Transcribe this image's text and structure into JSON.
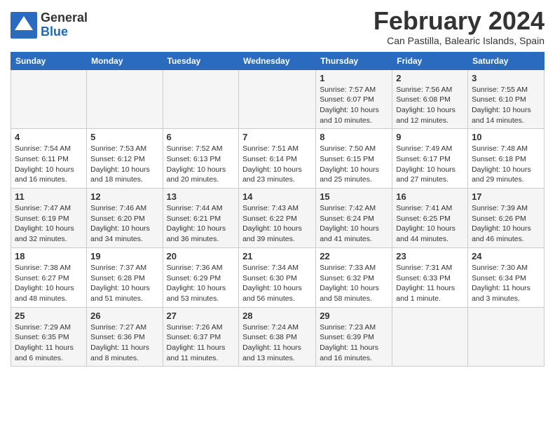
{
  "logo": {
    "general": "General",
    "blue": "Blue"
  },
  "header": {
    "month": "February 2024",
    "location": "Can Pastilla, Balearic Islands, Spain"
  },
  "days_of_week": [
    "Sunday",
    "Monday",
    "Tuesday",
    "Wednesday",
    "Thursday",
    "Friday",
    "Saturday"
  ],
  "weeks": [
    [
      {
        "day": "",
        "info": ""
      },
      {
        "day": "",
        "info": ""
      },
      {
        "day": "",
        "info": ""
      },
      {
        "day": "",
        "info": ""
      },
      {
        "day": "1",
        "info": "Sunrise: 7:57 AM\nSunset: 6:07 PM\nDaylight: 10 hours\nand 10 minutes."
      },
      {
        "day": "2",
        "info": "Sunrise: 7:56 AM\nSunset: 6:08 PM\nDaylight: 10 hours\nand 12 minutes."
      },
      {
        "day": "3",
        "info": "Sunrise: 7:55 AM\nSunset: 6:10 PM\nDaylight: 10 hours\nand 14 minutes."
      }
    ],
    [
      {
        "day": "4",
        "info": "Sunrise: 7:54 AM\nSunset: 6:11 PM\nDaylight: 10 hours\nand 16 minutes."
      },
      {
        "day": "5",
        "info": "Sunrise: 7:53 AM\nSunset: 6:12 PM\nDaylight: 10 hours\nand 18 minutes."
      },
      {
        "day": "6",
        "info": "Sunrise: 7:52 AM\nSunset: 6:13 PM\nDaylight: 10 hours\nand 20 minutes."
      },
      {
        "day": "7",
        "info": "Sunrise: 7:51 AM\nSunset: 6:14 PM\nDaylight: 10 hours\nand 23 minutes."
      },
      {
        "day": "8",
        "info": "Sunrise: 7:50 AM\nSunset: 6:15 PM\nDaylight: 10 hours\nand 25 minutes."
      },
      {
        "day": "9",
        "info": "Sunrise: 7:49 AM\nSunset: 6:17 PM\nDaylight: 10 hours\nand 27 minutes."
      },
      {
        "day": "10",
        "info": "Sunrise: 7:48 AM\nSunset: 6:18 PM\nDaylight: 10 hours\nand 29 minutes."
      }
    ],
    [
      {
        "day": "11",
        "info": "Sunrise: 7:47 AM\nSunset: 6:19 PM\nDaylight: 10 hours\nand 32 minutes."
      },
      {
        "day": "12",
        "info": "Sunrise: 7:46 AM\nSunset: 6:20 PM\nDaylight: 10 hours\nand 34 minutes."
      },
      {
        "day": "13",
        "info": "Sunrise: 7:44 AM\nSunset: 6:21 PM\nDaylight: 10 hours\nand 36 minutes."
      },
      {
        "day": "14",
        "info": "Sunrise: 7:43 AM\nSunset: 6:22 PM\nDaylight: 10 hours\nand 39 minutes."
      },
      {
        "day": "15",
        "info": "Sunrise: 7:42 AM\nSunset: 6:24 PM\nDaylight: 10 hours\nand 41 minutes."
      },
      {
        "day": "16",
        "info": "Sunrise: 7:41 AM\nSunset: 6:25 PM\nDaylight: 10 hours\nand 44 minutes."
      },
      {
        "day": "17",
        "info": "Sunrise: 7:39 AM\nSunset: 6:26 PM\nDaylight: 10 hours\nand 46 minutes."
      }
    ],
    [
      {
        "day": "18",
        "info": "Sunrise: 7:38 AM\nSunset: 6:27 PM\nDaylight: 10 hours\nand 48 minutes."
      },
      {
        "day": "19",
        "info": "Sunrise: 7:37 AM\nSunset: 6:28 PM\nDaylight: 10 hours\nand 51 minutes."
      },
      {
        "day": "20",
        "info": "Sunrise: 7:36 AM\nSunset: 6:29 PM\nDaylight: 10 hours\nand 53 minutes."
      },
      {
        "day": "21",
        "info": "Sunrise: 7:34 AM\nSunset: 6:30 PM\nDaylight: 10 hours\nand 56 minutes."
      },
      {
        "day": "22",
        "info": "Sunrise: 7:33 AM\nSunset: 6:32 PM\nDaylight: 10 hours\nand 58 minutes."
      },
      {
        "day": "23",
        "info": "Sunrise: 7:31 AM\nSunset: 6:33 PM\nDaylight: 11 hours\nand 1 minute."
      },
      {
        "day": "24",
        "info": "Sunrise: 7:30 AM\nSunset: 6:34 PM\nDaylight: 11 hours\nand 3 minutes."
      }
    ],
    [
      {
        "day": "25",
        "info": "Sunrise: 7:29 AM\nSunset: 6:35 PM\nDaylight: 11 hours\nand 6 minutes."
      },
      {
        "day": "26",
        "info": "Sunrise: 7:27 AM\nSunset: 6:36 PM\nDaylight: 11 hours\nand 8 minutes."
      },
      {
        "day": "27",
        "info": "Sunrise: 7:26 AM\nSunset: 6:37 PM\nDaylight: 11 hours\nand 11 minutes."
      },
      {
        "day": "28",
        "info": "Sunrise: 7:24 AM\nSunset: 6:38 PM\nDaylight: 11 hours\nand 13 minutes."
      },
      {
        "day": "29",
        "info": "Sunrise: 7:23 AM\nSunset: 6:39 PM\nDaylight: 11 hours\nand 16 minutes."
      },
      {
        "day": "",
        "info": ""
      },
      {
        "day": "",
        "info": ""
      }
    ]
  ]
}
